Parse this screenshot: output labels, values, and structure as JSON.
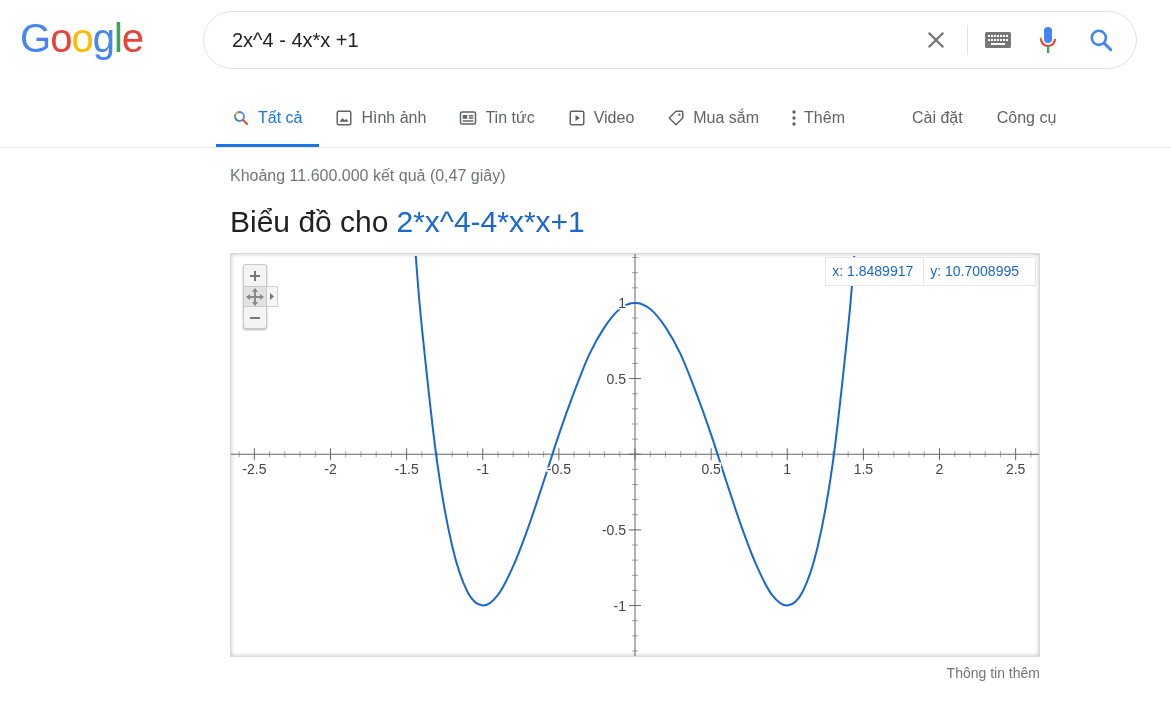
{
  "logo": {
    "letters": [
      {
        "char": "G",
        "color": "#4285f4"
      },
      {
        "char": "o",
        "color": "#ea4335"
      },
      {
        "char": "o",
        "color": "#fbbc05"
      },
      {
        "char": "g",
        "color": "#4285f4"
      },
      {
        "char": "l",
        "color": "#34a853"
      },
      {
        "char": "e",
        "color": "#ea4335"
      }
    ]
  },
  "search": {
    "value": "2x^4 - 4x*x +1"
  },
  "tabs": [
    {
      "label": "Tất cả",
      "kind": "search",
      "selected": true
    },
    {
      "label": "Hình ảnh",
      "kind": "image",
      "selected": false
    },
    {
      "label": "Tin tức",
      "kind": "news",
      "selected": false
    },
    {
      "label": "Video",
      "kind": "video",
      "selected": false
    },
    {
      "label": "Mua sắm",
      "kind": "tag",
      "selected": false
    },
    {
      "label": "Thêm",
      "kind": "more",
      "selected": false
    }
  ],
  "tools": [
    "Cài đặt",
    "Công cụ"
  ],
  "result_stats": "Khoảng 11.600.000 kết quả (0,47 giây)",
  "graph": {
    "title": "Biểu đồ cho",
    "expression": "2*x^4-4*x*x+1",
    "readout": {
      "x": "x: 1.8489917",
      "y": "y: 10.7008995"
    },
    "chart_data": {
      "type": "line",
      "x": [
        -1.44,
        -1.4,
        -1.3,
        -1.2,
        -1.1,
        -1.0,
        -0.9,
        -0.8,
        -0.7,
        -0.6,
        -0.5,
        -0.4,
        -0.3,
        -0.2,
        -0.1,
        0,
        0.1,
        0.2,
        0.3,
        0.4,
        0.5,
        0.6,
        0.7,
        0.8,
        0.9,
        1.0,
        1.1,
        1.2,
        1.3,
        1.4,
        1.44
      ],
      "series": [
        {
          "color": "#1967d2",
          "values": [
            1.31,
            0.84,
            -0.05,
            -0.61,
            -0.91,
            -1,
            -0.93,
            -0.74,
            -0.48,
            -0.18,
            0.13,
            0.41,
            0.66,
            0.84,
            0.96,
            1,
            0.96,
            0.84,
            0.66,
            0.41,
            0.13,
            -0.18,
            -0.48,
            -0.74,
            -0.93,
            -1,
            -0.91,
            -0.61,
            -0.05,
            0.84,
            1.31
          ]
        }
      ],
      "xlim": [
        -2.66,
        2.66
      ],
      "ylim": [
        -1.34,
        1.33
      ],
      "xticks": [
        -2.5,
        -2,
        -1.5,
        -1,
        -0.5,
        0.5,
        1,
        1.5,
        2,
        2.5
      ],
      "yticks": [
        -1,
        -0.5,
        0.5,
        1
      ]
    },
    "more_info": "Thông tin thêm"
  }
}
